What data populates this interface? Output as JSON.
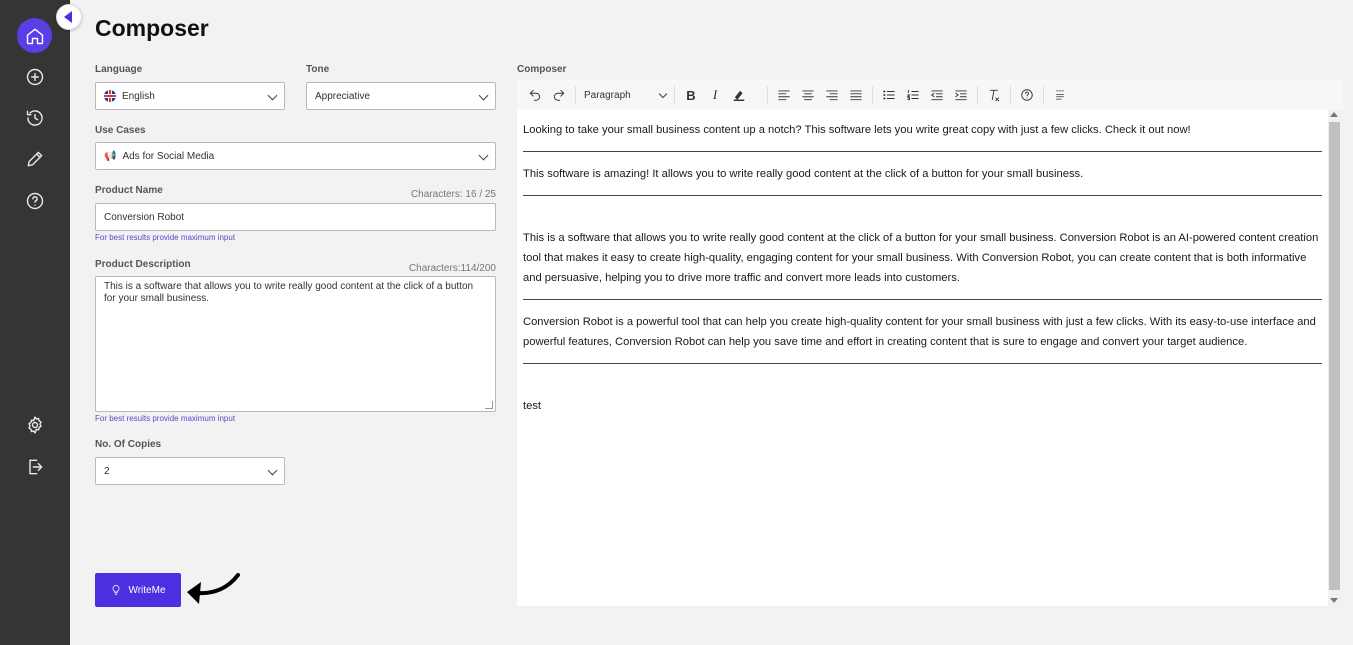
{
  "app": {
    "title": "Composer"
  },
  "sidebar": {
    "items": [
      {
        "icon": "home-icon",
        "active": true
      },
      {
        "icon": "plus-circle-icon"
      },
      {
        "icon": "history-icon"
      },
      {
        "icon": "pencil-icon"
      },
      {
        "icon": "help-icon"
      },
      {
        "icon": "settings-icon"
      },
      {
        "icon": "logout-icon"
      }
    ]
  },
  "form": {
    "language": {
      "label": "Language",
      "value": "English"
    },
    "tone": {
      "label": "Tone",
      "value": "Appreciative"
    },
    "use_cases": {
      "label": "Use Cases",
      "value": "Ads for Social Media"
    },
    "product_name": {
      "label": "Product Name",
      "counter": "Characters: 16 / 25",
      "value": "Conversion Robot",
      "hint": "For best results provide maximum input"
    },
    "product_description": {
      "label": "Product Description",
      "counter": "Characters:114/200",
      "value": "This is a software that allows you to write really good content at the click of a button for your small business.",
      "hint": "For best results provide maximum input"
    },
    "copies": {
      "label": "No. Of Copies",
      "value": "2"
    },
    "submit_label": "WriteMe"
  },
  "composer": {
    "label": "Composer",
    "toolbar": {
      "format": "Paragraph"
    },
    "paragraphs": [
      "Looking to take your small business content up a notch? This software lets you write great copy with just a few clicks. Check it out now!",
      "This software is amazing! It allows you to write really good content at the click of a button for your small business.",
      "This is a software that allows you to write really good content at the click of a button for your small business. Conversion Robot is an AI-powered content creation tool that makes it easy to create high-quality, engaging content for your small business. With Conversion Robot, you can create content that is both informative and persuasive, helping you to drive more traffic and convert more leads into customers.",
      "Conversion Robot is a powerful tool that can help you create high-quality content for your small business with just a few clicks. With its easy-to-use interface and powerful features, Conversion Robot can help you save time and effort in creating content that is sure to engage and convert your target audience.",
      "test"
    ]
  },
  "colors": {
    "accent": "#4b2fe0",
    "sidebar": "#353535"
  }
}
